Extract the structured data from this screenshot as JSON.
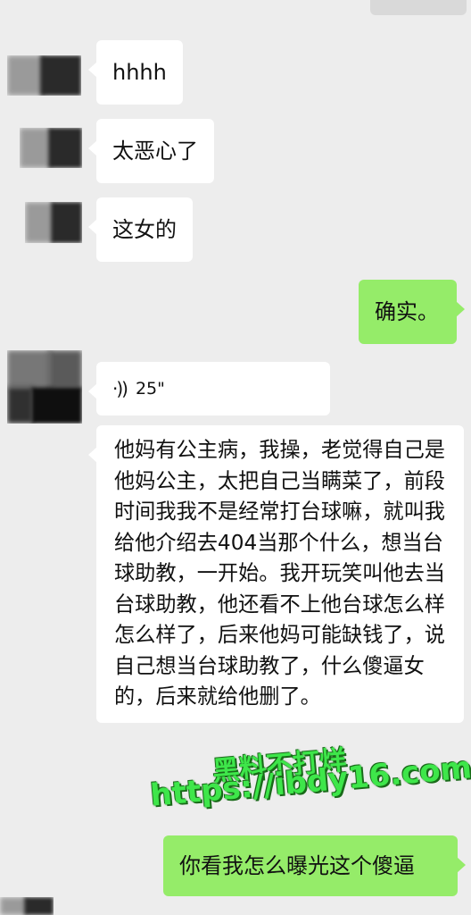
{
  "messages": [
    {
      "side": "in",
      "text": "hhhh"
    },
    {
      "side": "in",
      "text": "太恶心了"
    },
    {
      "side": "in",
      "text": "这女的"
    },
    {
      "side": "out",
      "text": "确实。"
    },
    {
      "side": "in",
      "type": "voice",
      "icon": "voice-icon",
      "duration": "25\""
    },
    {
      "side": "in",
      "type": "text",
      "text": "他妈有公主病，我操，老觉得自己是他妈公主，太把自己当瞒菜了，前段时间我我不是经常打台球嘛，就叫我给他介绍去404当那个什么，想当台球助教，一开始。我开玩笑叫他去当台球助教，他还看不上他台球怎么样怎么样了，后来他妈可能缺钱了，说自己想当台球助教了，什么傻逼女的，后来就给他删了。"
    },
    {
      "side": "out",
      "text": "你看我怎么曝光这个傻逼"
    }
  ],
  "watermark": {
    "line1": "黑料不打烊",
    "line2": "https://ibdy16.com",
    "color": "#3ee64a"
  },
  "colors": {
    "background": "#ededed",
    "incoming_bubble": "#ffffff",
    "outgoing_bubble": "#95ec69"
  }
}
